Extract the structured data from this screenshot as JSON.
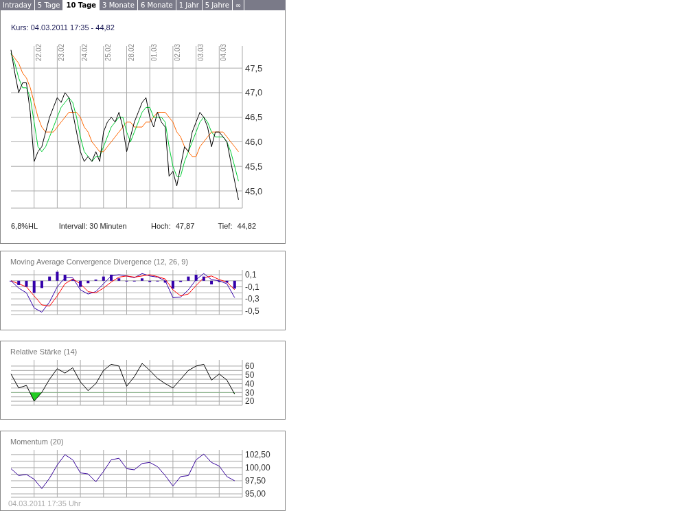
{
  "tabs": [
    {
      "label": "Intraday",
      "selected": false
    },
    {
      "label": "5 Tage",
      "selected": false
    },
    {
      "label": "10 Tage",
      "selected": true
    },
    {
      "label": "3 Monate",
      "selected": false
    },
    {
      "label": "6 Monate",
      "selected": false
    },
    {
      "label": "1 Jahr",
      "selected": false
    },
    {
      "label": "5 Jahre",
      "selected": false
    },
    {
      "label": "∞",
      "selected": false
    }
  ],
  "price_panel": {
    "quote": "Kurs: 04.03.2011 17:35 - 44,82",
    "date_labels": [
      "22.02.",
      "23.02.",
      "24.02.",
      "25.02.",
      "28.02.",
      "01.03.",
      "02.03.",
      "03.03.",
      "04.03."
    ],
    "chart_data": {
      "type": "line",
      "grid": true,
      "ylim": [
        44.65,
        47.95
      ],
      "yticks": [
        {
          "value": 47.5,
          "label": "47,5"
        },
        {
          "value": 47,
          "label": "47,0"
        },
        {
          "value": 46.5,
          "label": "46,5"
        },
        {
          "value": 46,
          "label": "46,0"
        },
        {
          "value": 45.5,
          "label": "45,5"
        },
        {
          "value": 45,
          "label": "45,0"
        }
      ],
      "series": [
        {
          "color": "#ff6600",
          "values": [
            47.8,
            47.7,
            47.6,
            47.4,
            47.3,
            47.1,
            46.8,
            46.5,
            46.3,
            46.2,
            46.2,
            46.2,
            46.3,
            46.4,
            46.5,
            46.6,
            46.6,
            46.6,
            46.5,
            46.3,
            46.2,
            46.0,
            45.9,
            45.8,
            45.8,
            45.9,
            46.0,
            46.1,
            46.2,
            46.3,
            46.4,
            46.4,
            46.3,
            46.3,
            46.3,
            46.4,
            46.4,
            46.5,
            46.6,
            46.6,
            46.6,
            46.5,
            46.4,
            46.2,
            46.1,
            45.9,
            45.8,
            45.7,
            45.7,
            45.9,
            46.0,
            46.1,
            46.2,
            46.2,
            46.2,
            46.2,
            46.1,
            46.0,
            45.9,
            45.8
          ]
        },
        {
          "color": "#00cc33",
          "values": [
            47.8,
            47.6,
            47.3,
            47.1,
            47.1,
            46.9,
            46.4,
            45.9,
            45.8,
            45.9,
            46.1,
            46.3,
            46.5,
            46.7,
            46.8,
            46.9,
            46.8,
            46.5,
            46.1,
            45.8,
            45.7,
            45.6,
            45.7,
            45.7,
            45.9,
            46.1,
            46.3,
            46.4,
            46.5,
            46.5,
            46.2,
            46.0,
            46.2,
            46.4,
            46.6,
            46.7,
            46.7,
            46.5,
            46.5,
            46.5,
            46.4,
            45.9,
            45.5,
            45.3,
            45.3,
            45.6,
            45.8,
            46.0,
            46.2,
            46.4,
            46.5,
            46.4,
            46.2,
            46.1,
            46.1,
            46.1,
            46.0,
            45.8,
            45.5,
            45.2
          ]
        },
        {
          "color": "#000000",
          "values": [
            47.87,
            47.4,
            47.0,
            47.2,
            47.2,
            46.6,
            45.6,
            45.8,
            45.9,
            46.2,
            46.5,
            46.7,
            46.9,
            46.8,
            47.0,
            46.9,
            46.6,
            46.2,
            45.8,
            45.6,
            45.7,
            45.6,
            45.8,
            45.6,
            46.2,
            46.4,
            46.5,
            46.4,
            46.6,
            46.3,
            45.8,
            46.1,
            46.4,
            46.6,
            46.8,
            46.9,
            46.5,
            46.3,
            46.6,
            46.4,
            46.3,
            45.3,
            45.4,
            45.1,
            45.5,
            45.9,
            45.8,
            46.2,
            46.4,
            46.6,
            46.5,
            46.3,
            45.9,
            46.2,
            46.2,
            46.1,
            46.0,
            45.6,
            45.2,
            44.82
          ]
        }
      ]
    },
    "stats": [
      {
        "label": "6,8%HL"
      },
      {
        "label": "Intervall: 30 Minuten"
      },
      {
        "label": "Hoch:",
        "value": "47,87"
      },
      {
        "label": "Tief:",
        "value": "44,82"
      }
    ]
  },
  "indicators": [
    {
      "kind": "macd",
      "title": "Moving Average Convergence Divergence (12, 26, 9)",
      "chart_data": {
        "type": "line",
        "grid": true,
        "ylim": [
          -0.56,
          0.18
        ],
        "yticks": [
          {
            "value": 0.1,
            "label": "0,1"
          },
          {
            "value": -0.1,
            "label": "-0,1"
          },
          {
            "value": -0.3,
            "label": "-0,3"
          },
          {
            "value": -0.5,
            "label": "-0,5"
          }
        ],
        "series": [
          {
            "color": "#3300aa",
            "values": [
              0.0,
              -0.12,
              -0.2,
              -0.45,
              -0.52,
              -0.35,
              -0.1,
              0.05,
              0.05,
              -0.15,
              -0.22,
              -0.18,
              -0.05,
              0.08,
              0.1,
              0.08,
              0.05,
              0.12,
              0.08,
              0.06,
              0.0,
              -0.28,
              -0.27,
              -0.15,
              0.02,
              0.12,
              0.02,
              0.0,
              -0.05,
              -0.28
            ]
          },
          {
            "color": "#ff0000",
            "values": [
              0.0,
              -0.05,
              -0.1,
              -0.25,
              -0.4,
              -0.42,
              -0.25,
              -0.05,
              0.03,
              -0.05,
              -0.18,
              -0.2,
              -0.12,
              -0.02,
              0.06,
              0.08,
              0.06,
              0.08,
              0.1,
              0.07,
              0.03,
              -0.15,
              -0.25,
              -0.22,
              -0.08,
              0.05,
              0.08,
              0.02,
              -0.02,
              -0.15
            ]
          },
          {
            "type": "bar",
            "color": "#3300aa",
            "values": [
              0,
              -0.07,
              -0.1,
              -0.2,
              -0.12,
              0.07,
              0.15,
              0.1,
              0.02,
              -0.1,
              -0.04,
              0.02,
              0.07,
              0.1,
              0.04,
              0,
              -0.01,
              0.04,
              -0.02,
              -0.01,
              -0.03,
              -0.13,
              -0.02,
              0.07,
              0.1,
              0.07,
              -0.06,
              -0.02,
              -0.03,
              -0.13
            ]
          }
        ]
      }
    },
    {
      "kind": "rsi",
      "title": "Relative Stärke (14)",
      "chart_data": {
        "type": "line",
        "grid": true,
        "ylim": [
          15.4,
          67
        ],
        "yticks": [
          {
            "value": 60,
            "label": "60"
          },
          {
            "value": 50,
            "label": "50"
          },
          {
            "value": 40,
            "label": "40"
          },
          {
            "value": 30,
            "label": "30"
          },
          {
            "value": 20,
            "label": "20"
          }
        ],
        "series": [
          {
            "color": "#000000",
            "values": [
              51,
              35,
              38,
              20,
              30,
              45,
              57,
              52,
              58,
              42,
              32,
              40,
              55,
              62,
              60,
              37,
              48,
              63,
              55,
              46,
              40,
              35,
              45,
              55,
              60,
              62,
              44,
              51,
              44,
              28
            ]
          }
        ]
      }
    },
    {
      "kind": "momentum",
      "title": "Momentum (20)",
      "timestamp": "04.03.2011 17:35 Uhr",
      "chart_data": {
        "type": "line",
        "grid": true,
        "ylim": [
          94.35,
          103.4
        ],
        "yticks": [
          {
            "value": 102.5,
            "label": "102,50"
          },
          {
            "value": 100,
            "label": "100,00"
          },
          {
            "value": 97.5,
            "label": "97,50"
          },
          {
            "value": 95,
            "label": "95,00"
          }
        ],
        "series": [
          {
            "color": "#330099",
            "values": [
              99.8,
              98.5,
              98.7,
              97.8,
              96.0,
              98.0,
              100.5,
              102.5,
              101.5,
              99.0,
              98.8,
              97.3,
              99.3,
              101.5,
              101.8,
              99.8,
              99.6,
              100.8,
              101.0,
              100.2,
              98.5,
              96.5,
              98.3,
              98.5,
              101.5,
              102.6,
              101.0,
              100.3,
              98.3,
              97.5
            ]
          }
        ]
      }
    }
  ]
}
